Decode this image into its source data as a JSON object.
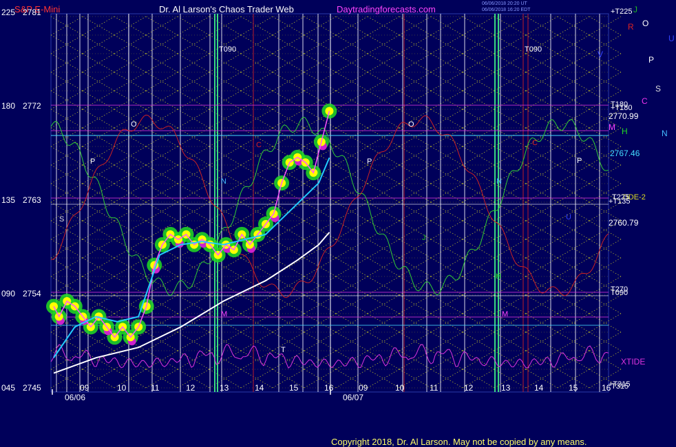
{
  "header": {
    "instrument": "S&P E-Mini",
    "title": "Dr. Al Larson's Chaos Trader Web",
    "site": "Daytradingforecasts.com",
    "date_line_1": "06/06/2018 20:20 UT",
    "date_line_2": "06/06/2018 16:20 EDT"
  },
  "footer": {
    "copyright": "Copyright 2018, Dr. Al Larson. May not be copied by any means."
  },
  "colors": {
    "background": "#00005a",
    "price": "#ffff00",
    "price_glow": "#22dd22",
    "mid_ma": "#22ccff",
    "slow_ma": "#ffffff",
    "xtide": "#dd33dd",
    "green_wave": "#33cc33",
    "red_wave": "#cc2222",
    "grid_lines": "#cccc33"
  },
  "chart_data": {
    "type": "line",
    "left_axis": {
      "angle_labels": [
        "225",
        "180",
        "135",
        "090",
        "045"
      ],
      "price_labels": [
        "2781",
        "2772",
        "2763",
        "2754",
        "2745"
      ],
      "ylim": [
        2745,
        2781
      ]
    },
    "time_axis": {
      "tick_labels": [
        "09",
        "10",
        "11",
        "12",
        "13",
        "14",
        "15",
        "16",
        "09",
        "10",
        "11",
        "12",
        "13",
        "14",
        "15",
        "16"
      ],
      "dates": [
        "06/06",
        "06/07"
      ]
    },
    "price_levels": [
      {
        "label": "2770.99",
        "color": "#ffffff"
      },
      {
        "label": "2767.46",
        "color": "#44ddff"
      },
      {
        "label": "2760.79",
        "color": "#ffffff"
      }
    ],
    "right_labels": [
      {
        "text": "+T225",
        "color": "#ffffff"
      },
      {
        "text": "J",
        "color": "#22bb22"
      },
      {
        "text": "R",
        "color": "#dd2222"
      },
      {
        "text": "O",
        "color": "#ffffff"
      },
      {
        "text": "U",
        "color": "#3344ff"
      },
      {
        "text": "V",
        "color": "#3344ff"
      },
      {
        "text": "P",
        "color": "#ffffff"
      },
      {
        "text": "S",
        "color": "#dddddd"
      },
      {
        "text": "C",
        "color": "#ee33ee"
      },
      {
        "text": "T180",
        "color": "#ffffff"
      },
      {
        "text": "+T180",
        "color": "#ffffff"
      },
      {
        "text": "M",
        "color": "#ff44ff"
      },
      {
        "text": "H",
        "color": "#22dd22"
      },
      {
        "text": "N",
        "color": "#44bbff"
      },
      {
        "text": "TIDE-2",
        "color": "#dddd22"
      },
      {
        "text": "+T135",
        "color": "#ffffff"
      },
      {
        "text": "T225",
        "color": "#ffffff"
      },
      {
        "text": "T090",
        "color": "#ffffff"
      },
      {
        "text": "T270",
        "color": "#ffffff"
      },
      {
        "text": "XTIDE",
        "color": "#dd33dd"
      },
      {
        "text": "T315",
        "color": "#ffffff"
      },
      {
        "text": "+T315",
        "color": "#ffffff"
      }
    ],
    "plot_annotations": [
      {
        "text": "T090",
        "color": "#ffffff"
      },
      {
        "text": "T090",
        "color": "#ffffff"
      },
      {
        "text": "O",
        "color": "#ffffff"
      },
      {
        "text": "O",
        "color": "#ffffff"
      },
      {
        "text": "P",
        "color": "#ffffff"
      },
      {
        "text": "P",
        "color": "#ffffff"
      },
      {
        "text": "P",
        "color": "#ffffff"
      },
      {
        "text": "S",
        "color": "#dddddd"
      },
      {
        "text": "C",
        "color": "#dd2222"
      },
      {
        "text": "C",
        "color": "#dd2222"
      },
      {
        "text": "N",
        "color": "#44bbff"
      },
      {
        "text": "N",
        "color": "#44bbff"
      },
      {
        "text": "M",
        "color": "#ff44ff"
      },
      {
        "text": "M",
        "color": "#ff44ff"
      },
      {
        "text": "H",
        "color": "#22dd22"
      },
      {
        "text": "U",
        "color": "#3344ff"
      },
      {
        "text": "J",
        "color": "#22bb22"
      },
      {
        "text": "T",
        "color": "#ffffff"
      }
    ],
    "series": [
      {
        "name": "price",
        "color": "#ffff00",
        "points": [
          [
            0,
            2753
          ],
          [
            0.1,
            2752
          ],
          [
            0.25,
            2753.5
          ],
          [
            0.4,
            2753
          ],
          [
            0.55,
            2752
          ],
          [
            0.7,
            2751
          ],
          [
            0.85,
            2752
          ],
          [
            1.0,
            2751
          ],
          [
            1.15,
            2750
          ],
          [
            1.3,
            2751
          ],
          [
            1.45,
            2750
          ],
          [
            1.6,
            2751
          ],
          [
            1.75,
            2753
          ],
          [
            1.9,
            2757
          ],
          [
            2.05,
            2759
          ],
          [
            2.2,
            2760
          ],
          [
            2.35,
            2759.5
          ],
          [
            2.5,
            2760
          ],
          [
            2.65,
            2759
          ],
          [
            2.8,
            2759.5
          ],
          [
            2.95,
            2759
          ],
          [
            3.1,
            2758
          ],
          [
            3.25,
            2759
          ],
          [
            3.4,
            2758.5
          ],
          [
            3.55,
            2760
          ],
          [
            3.7,
            2759
          ],
          [
            3.85,
            2760
          ],
          [
            4.0,
            2761
          ],
          [
            4.15,
            2762
          ],
          [
            4.3,
            2765
          ],
          [
            4.45,
            2767
          ],
          [
            4.6,
            2767.5
          ],
          [
            4.75,
            2767
          ],
          [
            4.9,
            2766
          ],
          [
            5.05,
            2769
          ],
          [
            5.2,
            2772
          ]
        ]
      },
      {
        "name": "mid_ma",
        "color": "#22ccff",
        "points": [
          [
            0,
            2748
          ],
          [
            0.4,
            2751
          ],
          [
            0.8,
            2752
          ],
          [
            1.2,
            2751.5
          ],
          [
            1.6,
            2752
          ],
          [
            2.0,
            2758
          ],
          [
            2.4,
            2759
          ],
          [
            2.8,
            2759.3
          ],
          [
            3.2,
            2759
          ],
          [
            3.6,
            2759.5
          ],
          [
            4.0,
            2760
          ],
          [
            4.4,
            2762
          ],
          [
            4.8,
            2764
          ],
          [
            5.0,
            2765
          ],
          [
            5.2,
            2767.46
          ]
        ]
      },
      {
        "name": "slow_ma",
        "color": "#ffffff",
        "points": [
          [
            0,
            2746.5
          ],
          [
            0.8,
            2748
          ],
          [
            1.6,
            2749
          ],
          [
            2.4,
            2751
          ],
          [
            3.2,
            2753.5
          ],
          [
            4.0,
            2755.5
          ],
          [
            4.6,
            2757.5
          ],
          [
            5.0,
            2759
          ],
          [
            5.2,
            2760.2
          ]
        ]
      }
    ]
  }
}
